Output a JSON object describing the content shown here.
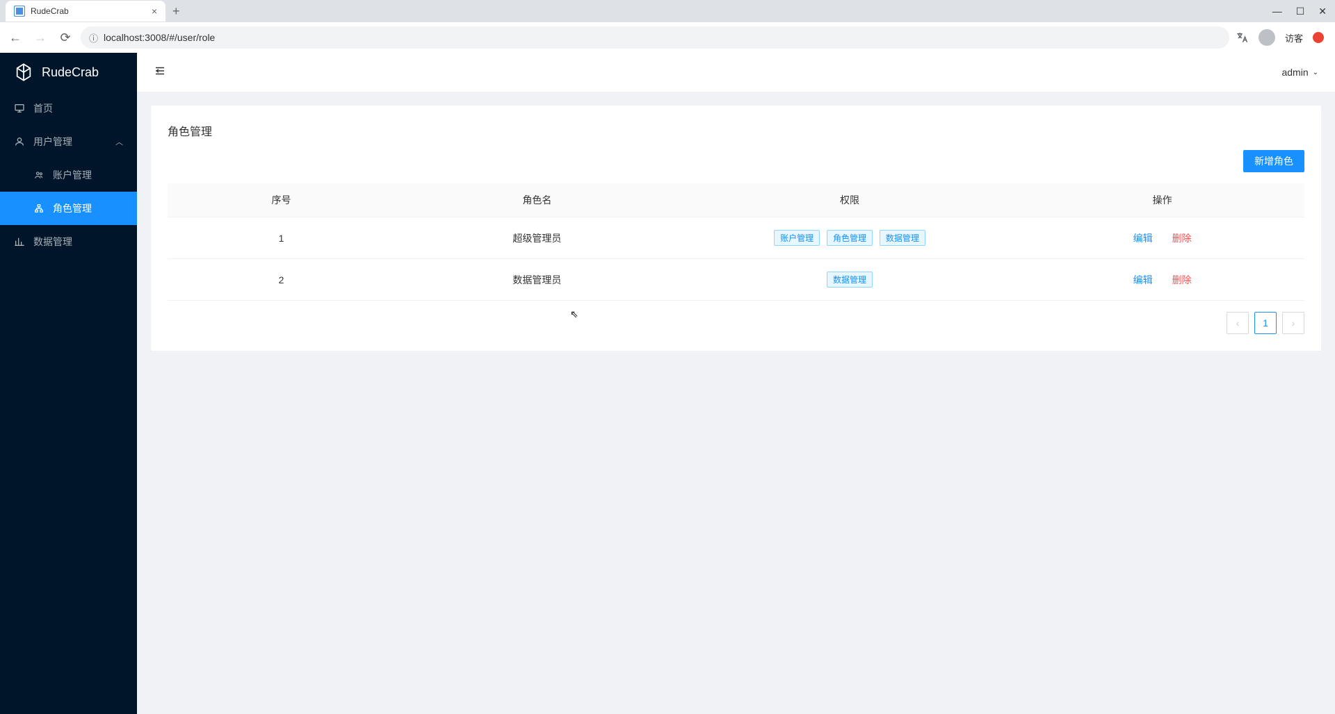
{
  "browser": {
    "tab_title": "RudeCrab",
    "url": "localhost:3008/#/user/role",
    "guest_label": "访客"
  },
  "app": {
    "logo_text": "RudeCrab",
    "header_user": "admin"
  },
  "sidebar": {
    "items": [
      {
        "label": "首页"
      },
      {
        "label": "用户管理"
      },
      {
        "label": "账户管理"
      },
      {
        "label": "角色管理"
      },
      {
        "label": "数据管理"
      }
    ]
  },
  "page": {
    "title": "角色管理",
    "add_button": "新增角色"
  },
  "table": {
    "headers": {
      "seq": "序号",
      "name": "角色名",
      "perm": "权限",
      "action": "操作"
    },
    "rows": [
      {
        "seq": "1",
        "name": "超级管理员",
        "perms": [
          "账户管理",
          "角色管理",
          "数据管理"
        ]
      },
      {
        "seq": "2",
        "name": "数据管理员",
        "perms": [
          "数据管理"
        ]
      }
    ],
    "actions": {
      "edit": "编辑",
      "delete": "删除"
    }
  },
  "pagination": {
    "current": "1"
  }
}
